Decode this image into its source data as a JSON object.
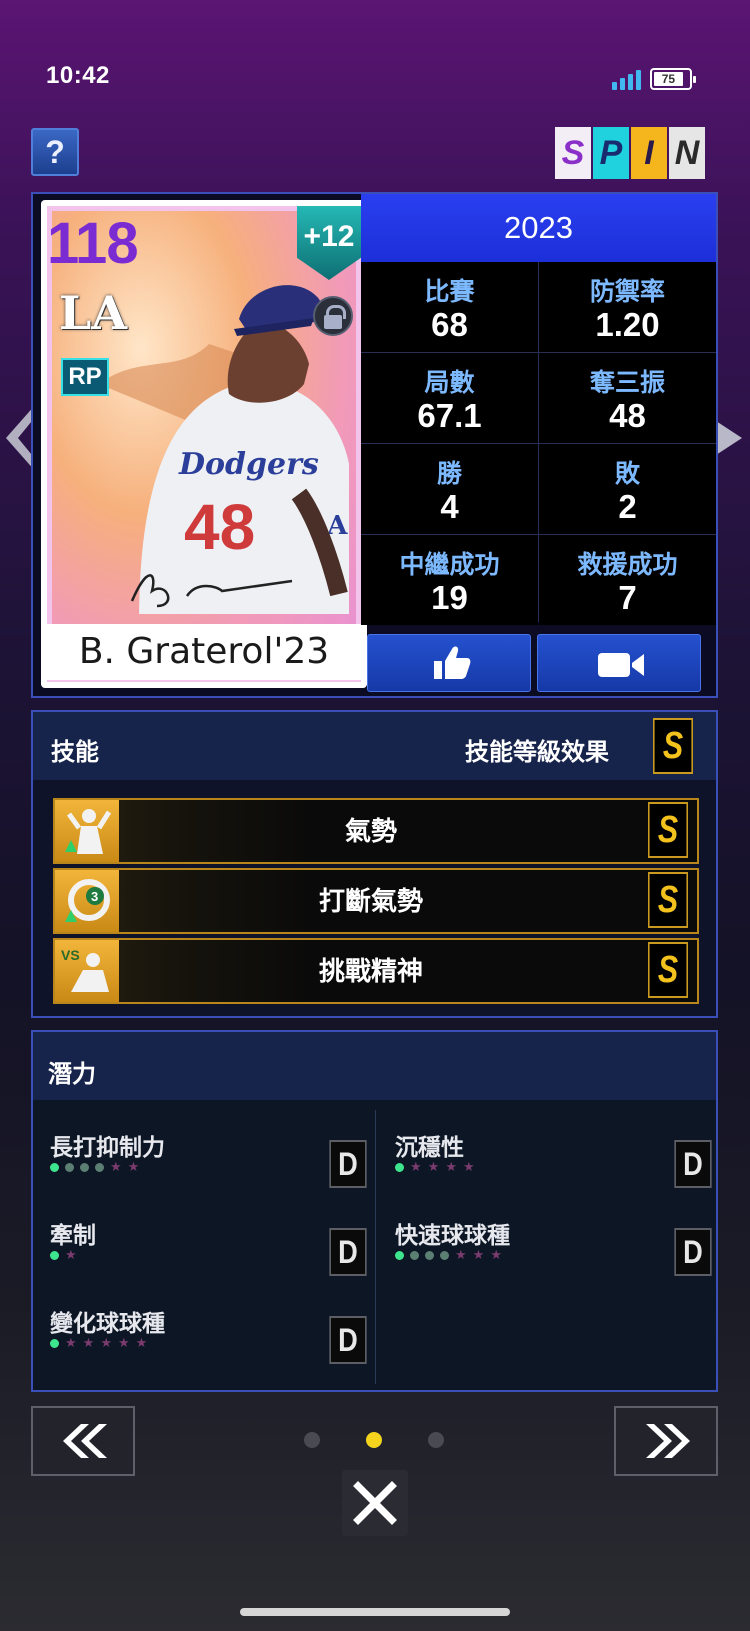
{
  "status_bar": {
    "time": "10:42",
    "battery": "75"
  },
  "header": {
    "help_label": "?",
    "spin_letters": [
      "S",
      "P",
      "I",
      "N"
    ]
  },
  "card": {
    "overall": "118",
    "team_logo": "LA",
    "position": "RP",
    "boost": "+12",
    "name": "B. Graterol'23",
    "jersey_number": "48"
  },
  "stats": {
    "year": "2023",
    "items": [
      {
        "label": "比賽",
        "value": "68"
      },
      {
        "label": "防禦率",
        "value": "1.20"
      },
      {
        "label": "局數",
        "value": "67.1"
      },
      {
        "label": "奪三振",
        "value": "48"
      },
      {
        "label": "勝",
        "value": "4"
      },
      {
        "label": "敗",
        "value": "2"
      },
      {
        "label": "中繼成功",
        "value": "19"
      },
      {
        "label": "救援成功",
        "value": "7"
      }
    ]
  },
  "skills": {
    "title": "技能",
    "effect_label": "技能等級效果",
    "effect_grade": "S",
    "items": [
      {
        "name": "氣勢",
        "grade": "S",
        "icon": "momentum-icon"
      },
      {
        "name": "打斷氣勢",
        "grade": "S",
        "icon": "break-momentum-icon"
      },
      {
        "name": "挑戰精神",
        "grade": "S",
        "icon": "challenge-spirit-icon"
      }
    ]
  },
  "potential": {
    "title": "潛力",
    "items": [
      {
        "name": "長打抑制力",
        "grade": "D",
        "on": 1,
        "mid": 3,
        "stars": 2
      },
      {
        "name": "沉穩性",
        "grade": "D",
        "on": 1,
        "mid": 0,
        "stars": 4
      },
      {
        "name": "牽制",
        "grade": "D",
        "on": 1,
        "mid": 0,
        "stars": 1
      },
      {
        "name": "快速球球種",
        "grade": "D",
        "on": 1,
        "mid": 3,
        "stars": 3
      },
      {
        "name": "變化球球種",
        "grade": "D",
        "on": 1,
        "mid": 0,
        "stars": 5
      }
    ]
  },
  "pagination": {
    "total": 3,
    "current": 2
  },
  "colors": {
    "accent_blue": "#2a3ff0",
    "gold": "#f4c21c",
    "stat_label": "#7db9ff",
    "active_dot": "#f4d41c"
  }
}
